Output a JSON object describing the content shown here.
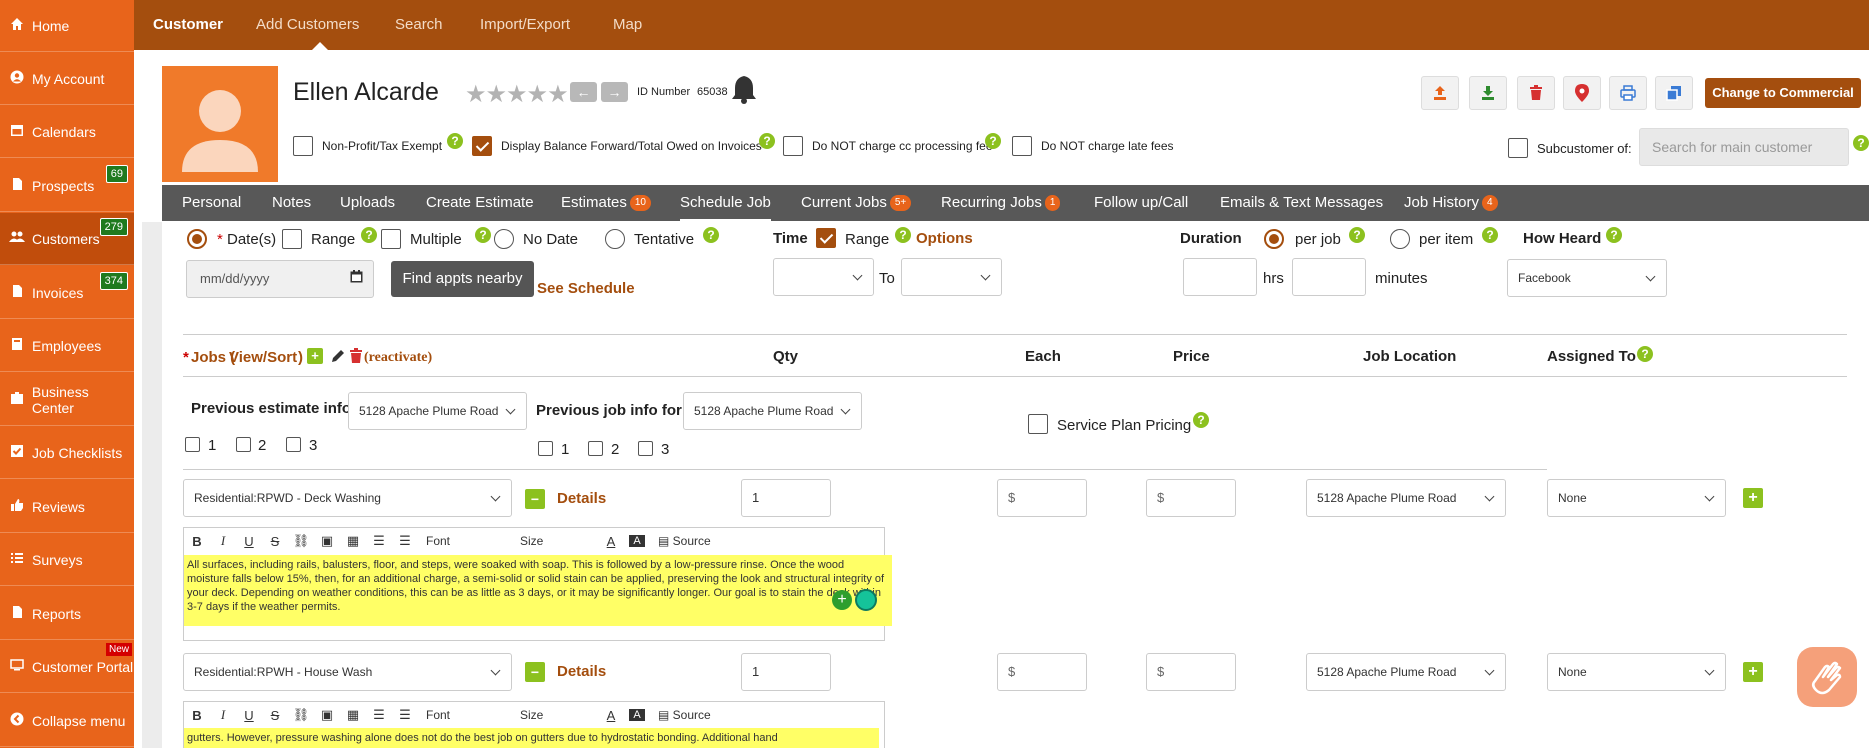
{
  "sidebar": {
    "items": [
      {
        "label": "Home",
        "icon": "home-icon"
      },
      {
        "label": "My Account",
        "icon": "user-circle-icon"
      },
      {
        "label": "Calendars",
        "icon": "calendar-icon"
      },
      {
        "label": "Prospects",
        "icon": "document-icon",
        "badge": "69"
      },
      {
        "label": "Customers",
        "icon": "users-icon",
        "badge": "279"
      },
      {
        "label": "Invoices",
        "icon": "invoice-icon",
        "badge": "374"
      },
      {
        "label": "Employees",
        "icon": "employees-icon"
      },
      {
        "label": "Business Center",
        "icon": "building-icon"
      },
      {
        "label": "Job Checklists",
        "icon": "checklist-icon"
      },
      {
        "label": "Reviews",
        "icon": "thumbs-up-icon"
      },
      {
        "label": "Surveys",
        "icon": "survey-icon"
      },
      {
        "label": "Reports",
        "icon": "report-icon"
      },
      {
        "label": "Customer Portal",
        "icon": "portal-icon",
        "new": "New"
      },
      {
        "label": "Collapse menu",
        "icon": "collapse-icon"
      }
    ]
  },
  "topnav": [
    "Customer",
    "Add Customers",
    "Search",
    "Import/Export",
    "Map"
  ],
  "customer": {
    "name": "Ellen Alcarde",
    "stars": "★★★★★",
    "id_label": "ID Number",
    "id_number": "65038"
  },
  "actions": {
    "commercial": "Change to Commercial"
  },
  "checks": {
    "nonprofit": "Non-Profit/Tax Exempt",
    "display_balance": "Display Balance Forward/Total Owed on Invoices",
    "no_cc_fee": "Do NOT charge cc processing fee",
    "no_late_fee": "Do NOT charge late fees",
    "subcustomer": "Subcustomer of:",
    "search_placeholder": "Search for main customer"
  },
  "tabs": [
    {
      "label": "Personal"
    },
    {
      "label": "Notes"
    },
    {
      "label": "Uploads"
    },
    {
      "label": "Create Estimate"
    },
    {
      "label": "Estimates",
      "badge": "10"
    },
    {
      "label": "Schedule Job"
    },
    {
      "label": "Current Jobs",
      "badge": "5+"
    },
    {
      "label": "Recurring Jobs",
      "badge": "1"
    },
    {
      "label": "Follow up/Call"
    },
    {
      "label": "Emails & Text Messages"
    },
    {
      "label": "Job History",
      "badge": "4"
    }
  ],
  "schedule": {
    "asterisk": "*",
    "dates": "Date(s)",
    "range": "Range",
    "multiple": "Multiple",
    "no_date": "No Date",
    "tentative": "Tentative",
    "date_placeholder": "mm/dd/yyyy",
    "find_btn": "Find appts nearby",
    "see_schedule": "See Schedule",
    "time": "Time",
    "time_range": "Range",
    "options": "Options",
    "to": "To",
    "duration": "Duration",
    "per_job": "per job",
    "per_item": "per item",
    "hrs": "hrs",
    "minutes": "minutes",
    "how_heard": "How Heard",
    "how_heard_value": "Facebook"
  },
  "jobs": {
    "asterisk": "*",
    "title": "Jobs (",
    "view_sort": "View/Sort",
    "close_paren": ")",
    "reactivate": "(reactivate)",
    "qty": "Qty",
    "each": "Each",
    "price": "Price",
    "location": "Job Location",
    "assigned": "Assigned To",
    "prev_estimate": "Previous estimate info",
    "prev_estimate_value": "5128 Apache Plume Road",
    "prev_job": "Previous job info for",
    "prev_job_value": "5128 Apache Plume Road",
    "n1": "1",
    "n2": "2",
    "n3": "3",
    "service_plan": "Service Plan Pricing",
    "rows": [
      {
        "service": "Residential:RPWD - Deck Washing",
        "details": "Details",
        "qty": "1",
        "each": "$",
        "price": "$",
        "location": "5128 Apache Plume Road",
        "assigned": "None",
        "description": "All surfaces, including rails, balusters, floor, and steps, were soaked with soap. This is followed by a low-pressure rinse. Once the wood moisture falls below 15%, then, for an additional charge, a semi-solid or solid stain can be applied, preserving the look and structural integrity of your deck. Depending on weather conditions, this can be as little as 3 days, or it may be significantly longer. Our goal is to stain the deck within 3-7 days if the weather permits."
      },
      {
        "service": "Residential:RPWH - House Wash",
        "details": "Details",
        "qty": "1",
        "each": "$",
        "price": "$",
        "location": "5128 Apache Plume Road",
        "assigned": "None",
        "description": "gutters. However, pressure washing alone does not do the best job on gutters due to hydrostatic bonding. Additional hand"
      }
    ]
  },
  "editor": {
    "bold": "B",
    "italic": "I",
    "underline": "U",
    "strike": "S",
    "font": "Font",
    "size": "Size",
    "text_color": "A",
    "bg_color": "A",
    "source": "Source"
  },
  "colors": {
    "sidebar": "#e8641b",
    "topnav": "#a44e0e",
    "accent": "#a44e0e",
    "help": "#8cc11f",
    "highlight": "#ffff66"
  }
}
